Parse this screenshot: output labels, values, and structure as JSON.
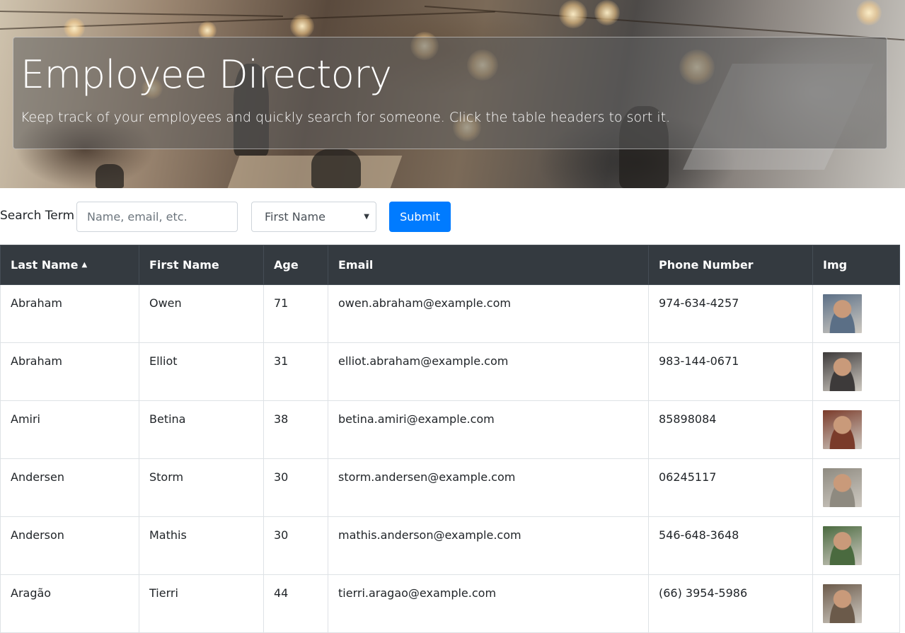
{
  "header": {
    "title": "Employee Directory",
    "subtitle": "Keep track of your employees and quickly search for someone. Click the table headers to sort it."
  },
  "search": {
    "label": "Search Term",
    "placeholder": "Name, email, etc.",
    "select_value": "First Name",
    "submit_label": "Submit"
  },
  "table": {
    "columns": [
      "Last Name",
      "First Name",
      "Age",
      "Email",
      "Phone Number",
      "Img"
    ],
    "sorted_column": "Last Name",
    "sort_direction": "ascending",
    "rows": [
      {
        "last": "Abraham",
        "first": "Owen",
        "age": "71",
        "email": "owen.abraham@example.com",
        "phone": "974-634-4257",
        "avatar_color": "#5b6f86"
      },
      {
        "last": "Abraham",
        "first": "Elliot",
        "age": "31",
        "email": "elliot.abraham@example.com",
        "phone": "983-144-0671",
        "avatar_color": "#3d3a3a"
      },
      {
        "last": "Amiri",
        "first": "Betina",
        "age": "38",
        "email": "betina.amiri@example.com",
        "phone": "85898084",
        "avatar_color": "#7a3b2a"
      },
      {
        "last": "Andersen",
        "first": "Storm",
        "age": "30",
        "email": "storm.andersen@example.com",
        "phone": "06245117",
        "avatar_color": "#8e8a80"
      },
      {
        "last": "Anderson",
        "first": "Mathis",
        "age": "30",
        "email": "mathis.anderson@example.com",
        "phone": "546-648-3648",
        "avatar_color": "#4a6a3f"
      },
      {
        "last": "Aragão",
        "first": "Tierri",
        "age": "44",
        "email": "tierri.aragao@example.com",
        "phone": "(66) 3954-5986",
        "avatar_color": "#6b5a4a"
      }
    ]
  }
}
